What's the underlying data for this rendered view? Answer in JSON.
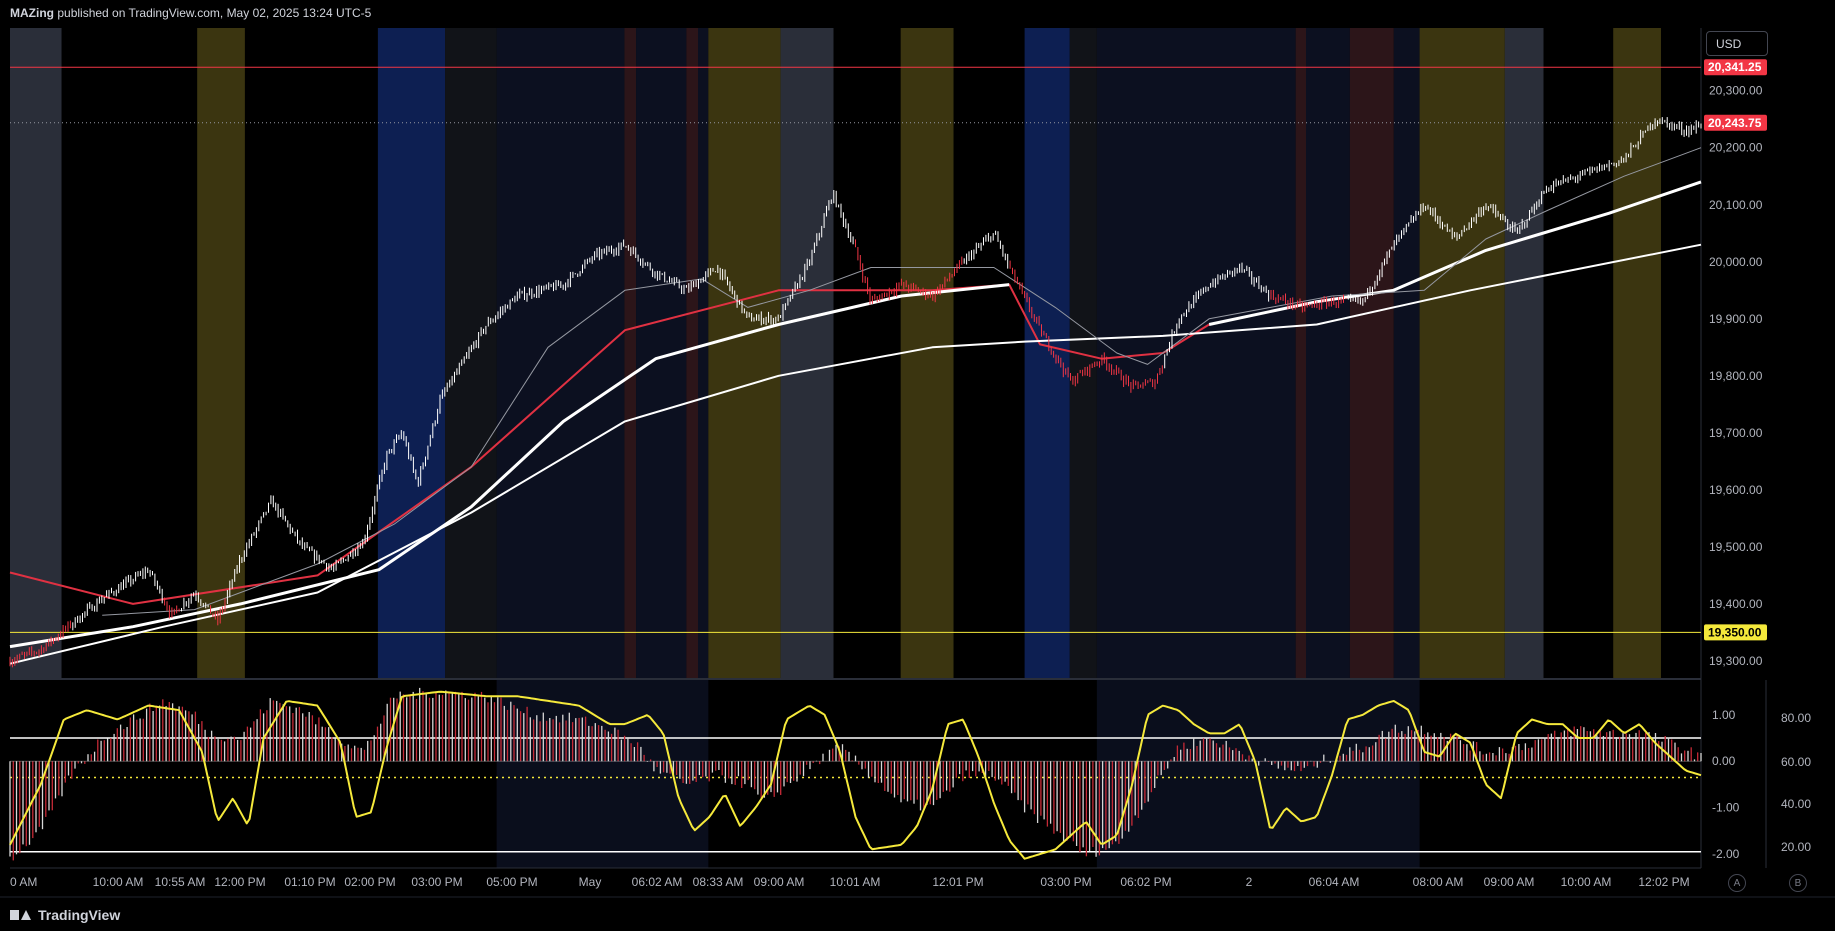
{
  "header": {
    "publisher": "MAZing",
    "published_text": "published on TradingView.com, May 02, 2025 13:24 UTC-5"
  },
  "footer": {
    "brand": "TradingView"
  },
  "toolbar": {
    "currency": "USD",
    "btn_a": "A",
    "btn_b": "B"
  },
  "colors": {
    "candle_up": "#ffffff",
    "candle_down": "#f23645",
    "ema_red": "#e03142",
    "osc_line": "#f5e93b",
    "level_red": "#f23645",
    "level_yellow": "#f5e93b"
  },
  "chart_data": [
    {
      "type": "candlestick",
      "title": "",
      "y_range": [
        19270,
        20410
      ],
      "y_ticks": [
        "20,300.00",
        "20,200.00",
        "20,100.00",
        "20,000.00",
        "19,900.00",
        "19,800.00",
        "19,700.00",
        "19,600.00",
        "19,500.00",
        "19,400.00",
        "19,300.00"
      ],
      "x_ticks": [
        "0 AM",
        "10:00 AM",
        "10:55 AM",
        "12:00 PM",
        "01:10 PM",
        "02:00 PM",
        "03:00 PM",
        "05:00 PM",
        "May",
        "06:02 AM",
        "08:33 AM",
        "09:00 AM",
        "10:01 AM",
        "12:01 PM",
        "03:00 PM",
        "06:02 PM",
        "2",
        "06:04 AM",
        "08:00 AM",
        "09:00 AM",
        "10:00 AM",
        "12:02 PM"
      ],
      "price_labels": [
        {
          "text": "20,341.25",
          "value": 20341.25,
          "color": "red"
        },
        {
          "text": "20,243.75",
          "value": 20243.75,
          "color": "red"
        },
        {
          "text": "19,350.00",
          "value": 19350,
          "color": "yellow"
        }
      ],
      "horizontal_levels": [
        20341.25,
        19350
      ],
      "last_price": 20243.75,
      "price_path": [
        [
          0,
          19300
        ],
        [
          2,
          19320
        ],
        [
          6,
          19410
        ],
        [
          9,
          19460
        ],
        [
          10.5,
          19380
        ],
        [
          12,
          19420
        ],
        [
          13.5,
          19370
        ],
        [
          15,
          19480
        ],
        [
          17,
          19580
        ],
        [
          19,
          19500
        ],
        [
          21,
          19460
        ],
        [
          23,
          19510
        ],
        [
          24.5,
          19660
        ],
        [
          25.5,
          19700
        ],
        [
          26.5,
          19610
        ],
        [
          28,
          19760
        ],
        [
          31,
          19890
        ],
        [
          33,
          19940
        ],
        [
          36,
          19960
        ],
        [
          38,
          20010
        ],
        [
          40,
          20030
        ],
        [
          42,
          19980
        ],
        [
          44,
          19950
        ],
        [
          46,
          19990
        ],
        [
          48,
          19900
        ],
        [
          50,
          19900
        ],
        [
          52,
          20000
        ],
        [
          53.5,
          20120
        ],
        [
          55,
          20020
        ],
        [
          56,
          19930
        ],
        [
          58,
          19960
        ],
        [
          60,
          19940
        ],
        [
          62,
          20000
        ],
        [
          64,
          20050
        ],
        [
          65,
          19990
        ],
        [
          67,
          19880
        ],
        [
          69,
          19790
        ],
        [
          71,
          19830
        ],
        [
          73,
          19780
        ],
        [
          74.5,
          19790
        ],
        [
          76,
          19900
        ],
        [
          78,
          19960
        ],
        [
          80,
          19990
        ],
        [
          82,
          19940
        ],
        [
          84,
          19920
        ],
        [
          86,
          19930
        ],
        [
          88,
          19930
        ],
        [
          90,
          20030
        ],
        [
          92,
          20100
        ],
        [
          94,
          20040
        ],
        [
          96,
          20100
        ],
        [
          98,
          20050
        ],
        [
          100,
          20130
        ],
        [
          103,
          20160
        ],
        [
          105,
          20180
        ],
        [
          107,
          20250
        ],
        [
          109,
          20230
        ],
        [
          110,
          20240
        ]
      ],
      "down_segments": [
        [
          0,
          4
        ],
        [
          10,
          11
        ],
        [
          13,
          14
        ],
        [
          55,
          62
        ],
        [
          65,
          75
        ],
        [
          82,
          87
        ]
      ],
      "moving_averages": [
        {
          "color": "#e03142",
          "width": 2,
          "points": [
            [
              0,
              19455
            ],
            [
              8,
              19400
            ],
            [
              20,
              19450
            ],
            [
              30,
              19640
            ],
            [
              40,
              19880
            ],
            [
              50,
              19950
            ],
            [
              60,
              19950
            ],
            [
              65,
              19960
            ],
            [
              67,
              19855
            ],
            [
              71,
              19830
            ],
            [
              75,
              19840
            ],
            [
              78,
              19890
            ]
          ]
        },
        {
          "color": "#ffffff",
          "width": 3,
          "points": [
            [
              78,
              19890
            ],
            [
              85,
              19930
            ],
            [
              90,
              19950
            ],
            [
              96,
              20020
            ],
            [
              104,
              20085
            ],
            [
              110,
              20140
            ]
          ]
        },
        {
          "color": "#ffffff",
          "width": 3,
          "points": [
            [
              0,
              19325
            ],
            [
              8,
              19360
            ],
            [
              15,
              19400
            ],
            [
              24,
              19460
            ],
            [
              30,
              19570
            ],
            [
              36,
              19720
            ],
            [
              42,
              19830
            ],
            [
              50,
              19890
            ],
            [
              58,
              19940
            ],
            [
              65,
              19960
            ]
          ]
        },
        {
          "color": "#ffffff",
          "width": 2,
          "points": [
            [
              0,
              19295
            ],
            [
              10,
              19360
            ],
            [
              20,
              19420
            ],
            [
              30,
              19560
            ],
            [
              40,
              19720
            ],
            [
              50,
              19800
            ],
            [
              60,
              19850
            ],
            [
              66,
              19860
            ],
            [
              75,
              19870
            ],
            [
              85,
              19890
            ],
            [
              95,
              19950
            ],
            [
              110,
              20030
            ]
          ]
        },
        {
          "color": "#9598a1",
          "width": 1,
          "points": [
            [
              6,
              19380
            ],
            [
              12,
              19390
            ],
            [
              20,
              19470
            ],
            [
              25,
              19540
            ],
            [
              30,
              19640
            ],
            [
              35,
              19850
            ],
            [
              40,
              19950
            ],
            [
              45,
              19970
            ],
            [
              48,
              19920
            ],
            [
              52,
              19950
            ],
            [
              56,
              19990
            ],
            [
              60,
              19990
            ],
            [
              64,
              19990
            ],
            [
              68,
              19920
            ],
            [
              72,
              19840
            ],
            [
              74,
              19820
            ],
            [
              78,
              19900
            ],
            [
              82,
              19920
            ],
            [
              86,
              19940
            ],
            [
              92,
              19950
            ],
            [
              96,
              20040
            ],
            [
              100,
              20090
            ],
            [
              105,
              20150
            ],
            [
              110,
              20200
            ]
          ]
        }
      ]
    },
    {
      "type": "oscillator",
      "y_ticks_left": [
        "1.00",
        "0.00",
        "-1.00",
        "-2.00"
      ],
      "y_ticks_right": [
        "80.00",
        "60.00",
        "40.00",
        "20.00"
      ],
      "histogram_path": [
        [
          0,
          -2.1
        ],
        [
          2,
          -1.5
        ],
        [
          4,
          -0.3
        ],
        [
          6,
          0.5
        ],
        [
          8,
          0.9
        ],
        [
          10,
          1.3
        ],
        [
          12,
          1.0
        ],
        [
          13,
          0.6
        ],
        [
          15,
          0.5
        ],
        [
          17,
          1.3
        ],
        [
          19,
          1.1
        ],
        [
          21,
          0.6
        ],
        [
          23,
          0.2
        ],
        [
          25,
          1.4
        ],
        [
          28,
          1.5
        ],
        [
          31,
          1.4
        ],
        [
          34,
          1.0
        ],
        [
          37,
          0.9
        ],
        [
          39,
          0.7
        ],
        [
          41,
          0.3
        ],
        [
          42,
          -0.2
        ],
        [
          44,
          -0.5
        ],
        [
          46,
          -0.3
        ],
        [
          48,
          -0.5
        ],
        [
          49,
          -0.9
        ],
        [
          51,
          -0.4
        ],
        [
          53,
          0.1
        ],
        [
          54,
          0.3
        ],
        [
          56,
          -0.3
        ],
        [
          58,
          -0.9
        ],
        [
          60,
          -1.0
        ],
        [
          62,
          -0.3
        ],
        [
          64,
          -0.3
        ],
        [
          66,
          -1.0
        ],
        [
          68,
          -1.5
        ],
        [
          70,
          -2.0
        ],
        [
          72,
          -1.8
        ],
        [
          74,
          -0.8
        ],
        [
          76,
          0.3
        ],
        [
          78,
          0.5
        ],
        [
          80,
          0.2
        ],
        [
          82,
          -0.1
        ],
        [
          84,
          -0.2
        ],
        [
          86,
          0.1
        ],
        [
          88,
          0.3
        ],
        [
          90,
          0.7
        ],
        [
          92,
          0.7
        ],
        [
          94,
          0.5
        ],
        [
          96,
          0.2
        ],
        [
          98,
          0.3
        ],
        [
          100,
          0.5
        ],
        [
          102,
          0.7
        ],
        [
          104,
          0.6
        ],
        [
          106,
          0.6
        ],
        [
          108,
          0.4
        ],
        [
          110,
          0.1
        ]
      ],
      "signal_path": [
        [
          0,
          -1.8
        ],
        [
          2,
          -0.5
        ],
        [
          3.5,
          0.9
        ],
        [
          5,
          1.1
        ],
        [
          7,
          0.9
        ],
        [
          9,
          1.2
        ],
        [
          11,
          1.1
        ],
        [
          12.5,
          0.2
        ],
        [
          13.5,
          -1.3
        ],
        [
          14.5,
          -0.8
        ],
        [
          15.5,
          -1.4
        ],
        [
          16.5,
          0.5
        ],
        [
          18,
          1.3
        ],
        [
          20,
          1.2
        ],
        [
          21.5,
          0.4
        ],
        [
          22.5,
          -1.2
        ],
        [
          23.5,
          -1.1
        ],
        [
          24.5,
          0.3
        ],
        [
          25.5,
          1.4
        ],
        [
          28,
          1.5
        ],
        [
          31,
          1.4
        ],
        [
          33,
          1.4
        ],
        [
          35,
          1.3
        ],
        [
          37,
          1.2
        ],
        [
          39,
          0.8
        ],
        [
          40,
          0.8
        ],
        [
          41.5,
          1.0
        ],
        [
          42.5,
          0.6
        ],
        [
          43.5,
          -0.8
        ],
        [
          44.5,
          -1.5
        ],
        [
          45.5,
          -1.2
        ],
        [
          46.5,
          -0.7
        ],
        [
          47.5,
          -1.4
        ],
        [
          48.5,
          -1.0
        ],
        [
          49.5,
          -0.5
        ],
        [
          50.5,
          0.9
        ],
        [
          52,
          1.2
        ],
        [
          53,
          1.0
        ],
        [
          54,
          0.2
        ],
        [
          55,
          -1.2
        ],
        [
          56,
          -1.9
        ],
        [
          58,
          -1.8
        ],
        [
          59,
          -1.4
        ],
        [
          60,
          -0.6
        ],
        [
          61,
          0.8
        ],
        [
          62,
          0.9
        ],
        [
          63,
          0.1
        ],
        [
          64,
          -0.9
        ],
        [
          65,
          -1.7
        ],
        [
          66,
          -2.1
        ],
        [
          68,
          -1.9
        ],
        [
          69,
          -1.6
        ],
        [
          70,
          -1.3
        ],
        [
          71,
          -1.8
        ],
        [
          72,
          -1.6
        ],
        [
          73,
          -0.5
        ],
        [
          74,
          1.0
        ],
        [
          75,
          1.2
        ],
        [
          76,
          1.1
        ],
        [
          77,
          0.8
        ],
        [
          78,
          0.6
        ],
        [
          79,
          0.6
        ],
        [
          80,
          0.8
        ],
        [
          81,
          0.0
        ],
        [
          82,
          -1.5
        ],
        [
          83,
          -1.0
        ],
        [
          84,
          -1.3
        ],
        [
          85,
          -1.2
        ],
        [
          86,
          -0.3
        ],
        [
          87,
          0.9
        ],
        [
          88,
          1.0
        ],
        [
          89,
          1.2
        ],
        [
          90,
          1.3
        ],
        [
          91,
          1.1
        ],
        [
          92,
          0.2
        ],
        [
          93,
          0.1
        ],
        [
          94,
          0.6
        ],
        [
          95,
          0.4
        ],
        [
          96,
          -0.5
        ],
        [
          97,
          -0.8
        ],
        [
          98,
          0.6
        ],
        [
          99,
          0.9
        ],
        [
          100,
          0.8
        ],
        [
          101,
          0.8
        ],
        [
          102,
          0.5
        ],
        [
          103,
          0.5
        ],
        [
          104,
          0.9
        ],
        [
          105,
          0.6
        ],
        [
          106,
          0.8
        ],
        [
          107,
          0.4
        ],
        [
          108,
          0.1
        ],
        [
          109,
          -0.2
        ],
        [
          110,
          -0.3
        ]
      ],
      "levels": [
        0.5,
        -1.95,
        -0.35
      ]
    }
  ]
}
